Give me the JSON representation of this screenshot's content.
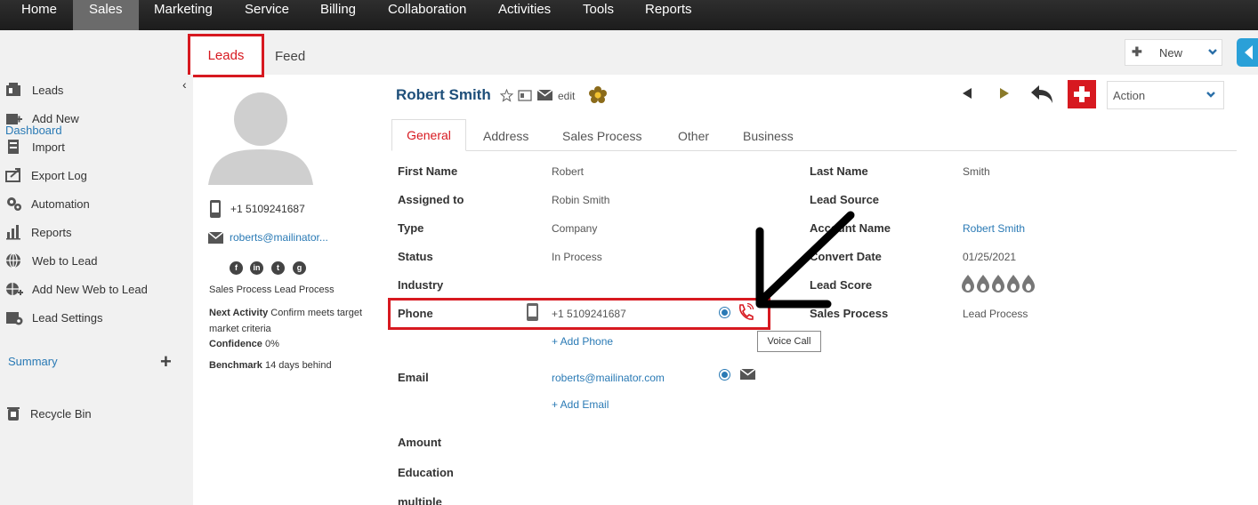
{
  "nav": {
    "items": [
      "Home",
      "Sales",
      "Marketing",
      "Service",
      "Billing",
      "Collaboration",
      "Activities",
      "Tools",
      "Reports"
    ],
    "active": "Sales"
  },
  "subheader": {
    "tabs": [
      "Leads",
      "Feed"
    ],
    "new_label": "New"
  },
  "sidebar": {
    "dashboard": "Dashboard",
    "items": [
      {
        "label": "Leads",
        "icon": "leads-icon"
      },
      {
        "label": "Add New",
        "icon": "add-new-icon"
      },
      {
        "label": "Import",
        "icon": "import-icon"
      },
      {
        "label": "Export Log",
        "icon": "export-log-icon"
      },
      {
        "label": "Automation",
        "icon": "automation-icon"
      },
      {
        "label": "Reports",
        "icon": "reports-icon"
      },
      {
        "label": "Web to Lead",
        "icon": "web-to-lead-icon"
      },
      {
        "label": "Add New Web to Lead",
        "icon": "add-web-to-lead-icon"
      },
      {
        "label": "Lead Settings",
        "icon": "lead-settings-icon"
      }
    ],
    "summary": "Summary",
    "recycle_bin": "Recycle Bin"
  },
  "profile": {
    "phone": "+1 5109241687",
    "email": "roberts@mailinator...",
    "sales_process_label": "Sales Process",
    "sales_process_value": "Lead Process",
    "next_activity_label": "Next Activity",
    "next_activity_value": "Confirm meets target market criteria",
    "confidence_label": "Confidence",
    "confidence_value": "0%",
    "benchmark_label": "Benchmark",
    "benchmark_value": "14 days behind"
  },
  "header": {
    "name": "Robert Smith",
    "edit": "edit",
    "action_label": "Action"
  },
  "tabs": [
    "General",
    "Address",
    "Sales Process",
    "Other",
    "Business"
  ],
  "fields_left": [
    {
      "label": "First Name",
      "value": "Robert"
    },
    {
      "label": "Assigned to",
      "value": "Robin Smith"
    },
    {
      "label": "Type",
      "value": "Company"
    },
    {
      "label": "Status",
      "value": "In Process"
    },
    {
      "label": "Industry",
      "value": ""
    },
    {
      "label": "Phone",
      "value": "+1 5109241687"
    }
  ],
  "fields_right": [
    {
      "label": "Last Name",
      "value": "Smith"
    },
    {
      "label": "Lead Source",
      "value": ""
    },
    {
      "label": "Account Name",
      "value": "Robert Smith"
    },
    {
      "label": "Convert Date",
      "value": "01/25/2021"
    },
    {
      "label": "Lead Score",
      "value": ""
    },
    {
      "label": "Sales Process",
      "value": "Lead Process"
    }
  ],
  "add_phone": "+ Add Phone",
  "email_field": {
    "label": "Email",
    "value": "roberts@mailinator.com"
  },
  "add_email": "+ Add Email",
  "more_fields": [
    "Amount",
    "Education",
    "multiple"
  ],
  "tooltip": "Voice Call",
  "colors": {
    "accent_red": "#d71920",
    "link_blue": "#2a7ab5",
    "name_blue": "#1e4f7a"
  }
}
